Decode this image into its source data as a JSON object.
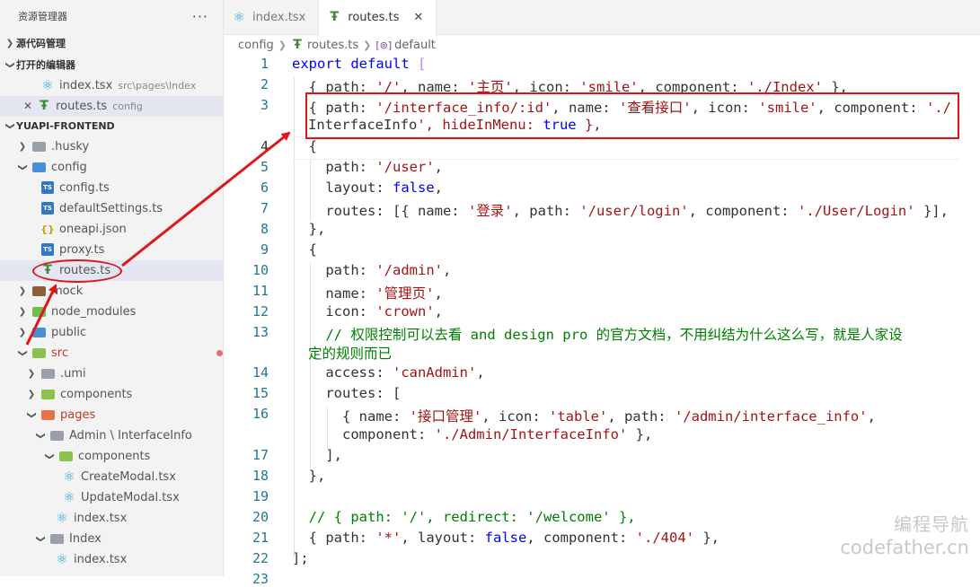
{
  "sidebar": {
    "title": "资源管理器",
    "more": "···",
    "sections": {
      "scm": "源代码管理",
      "open_editors": "打开的编辑器",
      "project": "YUAPI-FRONTEND"
    },
    "open_editors": [
      {
        "name": "index.tsx",
        "path": "src\\pages\\Index"
      },
      {
        "name": "routes.ts",
        "path": "config"
      }
    ],
    "tree": [
      {
        "label": ".husky"
      },
      {
        "label": "config"
      },
      {
        "label": "config.ts"
      },
      {
        "label": "defaultSettings.ts"
      },
      {
        "label": "oneapi.json"
      },
      {
        "label": "proxy.ts"
      },
      {
        "label": "routes.ts"
      },
      {
        "label": "mock"
      },
      {
        "label": "node_modules"
      },
      {
        "label": "public"
      },
      {
        "label": "src"
      },
      {
        "label": ".umi"
      },
      {
        "label": "components"
      },
      {
        "label": "pages"
      },
      {
        "label": "Admin \\ InterfaceInfo"
      },
      {
        "label": "components"
      },
      {
        "label": "CreateModal.tsx"
      },
      {
        "label": "UpdateModal.tsx"
      },
      {
        "label": "index.tsx"
      },
      {
        "label": "Index"
      },
      {
        "label": "index.tsx"
      }
    ]
  },
  "tabs": [
    {
      "label": "index.tsx"
    },
    {
      "label": "routes.ts"
    }
  ],
  "breadcrumb": [
    "config",
    "routes.ts",
    "default"
  ],
  "code": {
    "l1": {
      "n": "1",
      "a": "export",
      "b": " default ",
      "c": "["
    },
    "l2": {
      "n": "2",
      "t": "  { path: '/', name: '主页', icon: 'smile', component: './Index' },"
    },
    "l3": {
      "n": "3",
      "t": "  { path: '/interface_info/:id', name: '查看接口', icon: 'smile', component: './",
      "t2": "InterfaceInfo', hideInMenu: true },"
    },
    "l4": {
      "n": "4",
      "t": "  {"
    },
    "l5": {
      "n": "5",
      "t": "    path: '/user',"
    },
    "l6": {
      "n": "6",
      "t": "    layout: false,"
    },
    "l7": {
      "n": "7",
      "t": "    routes: [{ name: '登录', path: '/user/login', component: './User/Login' }],"
    },
    "l8": {
      "n": "8",
      "t": "  },"
    },
    "l9": {
      "n": "9",
      "t": "  {"
    },
    "l10": {
      "n": "10",
      "t": "    path: '/admin',"
    },
    "l11": {
      "n": "11",
      "t": "    name: '管理页',"
    },
    "l12": {
      "n": "12",
      "t": "    icon: 'crown',"
    },
    "l13": {
      "n": "13",
      "t": "    // 权限控制可以去看 and design pro 的官方文档，不用纠结为什么这么写，就是人家设",
      "t2": "定的规则而已"
    },
    "l14": {
      "n": "14",
      "t": "    access: 'canAdmin',"
    },
    "l15": {
      "n": "15",
      "t": "    routes: ["
    },
    "l16": {
      "n": "16",
      "t": "      { name: '接口管理', icon: 'table', path: '/admin/interface_info',",
      "t2": "      component: './Admin/InterfaceInfo' },"
    },
    "l17": {
      "n": "17",
      "t": "    ],"
    },
    "l18": {
      "n": "18",
      "t": "  },"
    },
    "l19": {
      "n": "19",
      "t": ""
    },
    "l20": {
      "n": "20",
      "t": "  // { path: '/', redirect: '/welcome' },"
    },
    "l21": {
      "n": "21",
      "t": "  { path: '*', layout: false, component: './404' },"
    },
    "l22": {
      "n": "22",
      "t": "];"
    },
    "l23": {
      "n": "23",
      "t": ""
    }
  },
  "watermark": {
    "line1": "编程导航",
    "line2": "codefather.cn"
  },
  "colors": {
    "annotation": "#e0151b",
    "keyword": "#0000ff",
    "string": "#a31515",
    "comment": "#008000",
    "line_number": "#237893"
  }
}
